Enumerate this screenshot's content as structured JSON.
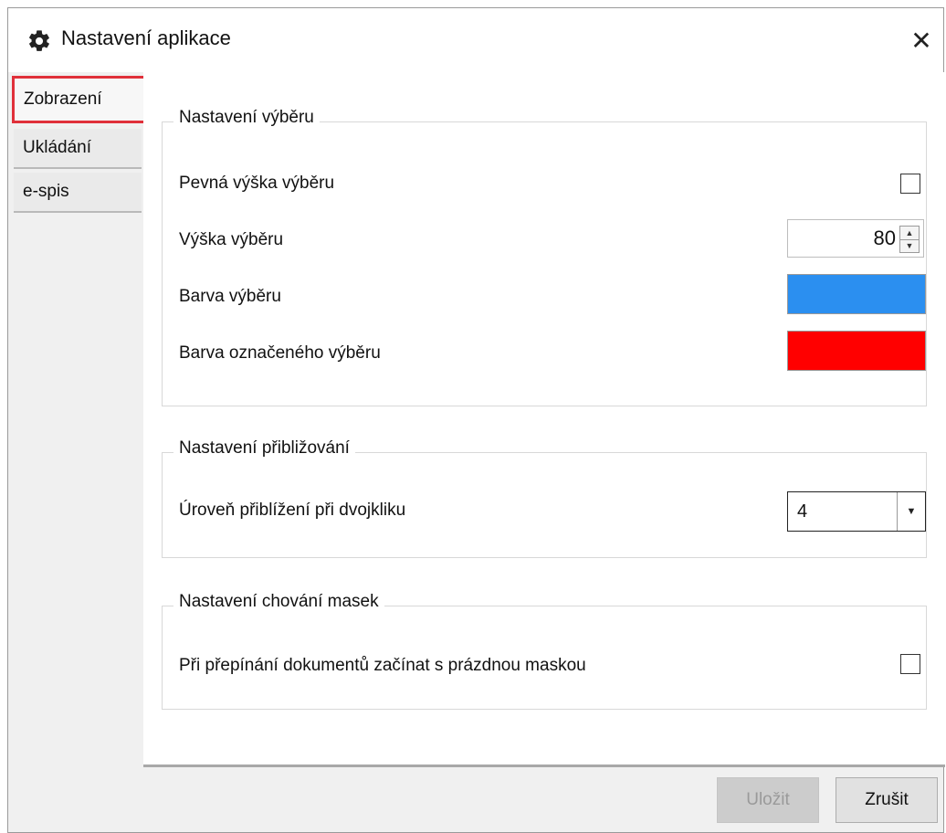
{
  "window": {
    "title": "Nastavení aplikace",
    "title_icon": "gear-icon",
    "close_glyph": "✕"
  },
  "sidebar": {
    "items": [
      {
        "label": "Zobrazení",
        "active": true
      },
      {
        "label": "Ukládání",
        "active": false
      },
      {
        "label": "e-spis",
        "active": false
      }
    ]
  },
  "groups": {
    "selection": {
      "legend": "Nastavení výběru",
      "fixed_height_label": "Pevná výška výběru",
      "fixed_height_checked": false,
      "height_label": "Výška výběru",
      "height_value": "80",
      "color_label": "Barva výběru",
      "color_value": "#2b8ff0",
      "selected_color_label": "Barva označeného výběru",
      "selected_color_value": "#ff0000"
    },
    "zoom": {
      "legend": "Nastavení přibližování",
      "double_click_label": "Úroveň přiblížení při dvojkliku",
      "double_click_value": "4"
    },
    "masks": {
      "legend": "Nastavení chování masek",
      "empty_mask_label": "Při přepínání dokumentů začínat s prázdnou maskou",
      "empty_mask_checked": false
    }
  },
  "buttons": {
    "save_label": "Uložit",
    "save_enabled": false,
    "cancel_label": "Zrušit"
  },
  "colors": {
    "active_tab_highlight": "#e0303a"
  }
}
